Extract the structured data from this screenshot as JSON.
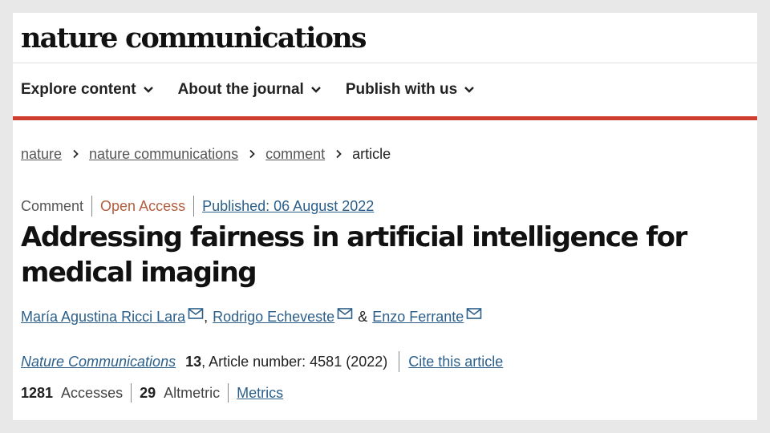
{
  "brand": {
    "logo": "nature communications"
  },
  "nav": {
    "items": [
      {
        "label": "Explore content"
      },
      {
        "label": "About the journal"
      },
      {
        "label": "Publish with us"
      }
    ]
  },
  "breadcrumb": {
    "items": [
      "nature",
      "nature communications",
      "comment"
    ],
    "current": "article"
  },
  "article": {
    "type": "Comment",
    "access": "Open Access",
    "published": "Published: 06 August 2022",
    "title": "Addressing fairness in artificial intelligence for medical imaging",
    "authors": [
      "María Agustina Ricci Lara",
      "Rodrigo Echeveste",
      "Enzo Ferrante"
    ],
    "author_separators": [
      ",",
      "&"
    ],
    "journal": "Nature Communications",
    "volume": "13",
    "article_info": ", Article number: 4581 (2022)",
    "cite_label": "Cite this article",
    "accesses_count": "1281",
    "accesses_label": "Accesses",
    "altmetric_count": "29",
    "altmetric_label": "Altmetric",
    "metrics_label": "Metrics"
  },
  "colors": {
    "accent_red": "#cf3d2f",
    "link_blue": "#2b5f8a",
    "open_access": "#b15f3e"
  },
  "icons": {
    "nav_dropdown": "chevron-down-icon",
    "breadcrumb_separator": "chevron-right-icon",
    "author_contact": "mail-icon"
  }
}
